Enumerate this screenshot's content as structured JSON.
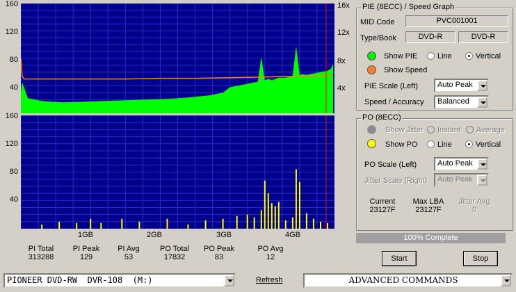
{
  "pie_graph": {
    "y_left_ticks": [
      "160",
      "120",
      "80",
      "40"
    ],
    "y_right_ticks": [
      "16x",
      "12x",
      "8x",
      "4x"
    ]
  },
  "po_graph": {
    "y_left_ticks": [
      "160",
      "120",
      "80",
      "40"
    ]
  },
  "x_axis_ticks": [
    "1GB",
    "2GB",
    "3GB",
    "4GB"
  ],
  "chart_data": [
    {
      "type": "area",
      "title": "PIE (8ECC)",
      "x_unit": "GB",
      "xlim": [
        0,
        4.5
      ],
      "ylim": [
        0,
        160
      ],
      "y2lim": [
        0,
        16
      ],
      "series": [
        {
          "name": "PIE",
          "color": "#00ff00",
          "x": [
            0,
            0.02,
            0.1,
            0.3,
            0.6,
            0.9,
            1.2,
            1.5,
            1.8,
            2.1,
            2.4,
            2.7,
            2.9,
            3.0,
            3.1,
            3.2,
            3.3,
            3.4,
            3.45,
            3.5,
            3.55,
            3.6,
            3.7,
            3.8,
            3.9,
            3.95,
            4.0,
            4.05,
            4.1,
            4.2,
            4.3,
            4.4,
            4.45,
            4.48
          ],
          "y": [
            30,
            45,
            22,
            18,
            16,
            17,
            18,
            19,
            20,
            21,
            23,
            26,
            30,
            38,
            40,
            42,
            44,
            46,
            82,
            48,
            50,
            48,
            52,
            52,
            55,
            98,
            56,
            57,
            56,
            58,
            60,
            62,
            65,
            72
          ]
        },
        {
          "name": "Speed",
          "color": "#ff8000",
          "x": [
            0,
            0.02,
            0.05,
            0.5,
            1.0,
            1.5,
            2.0,
            2.5,
            3.0,
            3.5,
            4.0,
            4.48
          ],
          "y": [
            8.0,
            5.4,
            5.0,
            5.0,
            5.0,
            5.0,
            5.1,
            5.1,
            5.2,
            5.3,
            5.4,
            5.6
          ]
        }
      ]
    },
    {
      "type": "bar",
      "title": "PO (8ECC)",
      "x_unit": "GB",
      "xlim": [
        0,
        4.5
      ],
      "ylim": [
        0,
        160
      ],
      "series": [
        {
          "name": "PO",
          "color": "#ffff00",
          "x": [
            0.3,
            0.55,
            0.8,
            1.0,
            1.15,
            1.45,
            1.7,
            2.1,
            2.4,
            2.65,
            2.9,
            3.1,
            3.25,
            3.35,
            3.45,
            3.5,
            3.55,
            3.6,
            3.65,
            3.7,
            3.8,
            3.9,
            3.95,
            4.0,
            4.1,
            4.2,
            4.3,
            4.4
          ],
          "y": [
            6,
            10,
            8,
            14,
            8,
            14,
            10,
            14,
            6,
            12,
            14,
            18,
            20,
            16,
            26,
            68,
            50,
            36,
            32,
            38,
            12,
            16,
            84,
            66,
            22,
            14,
            10,
            8
          ]
        }
      ]
    }
  ],
  "stats": [
    {
      "label": "PI Total",
      "value": "313288"
    },
    {
      "label": "PI Peak",
      "value": "129"
    },
    {
      "label": "PI Avg",
      "value": "53"
    },
    {
      "label": "PO Total",
      "value": "17832"
    },
    {
      "label": "PO Peak",
      "value": "83"
    },
    {
      "label": "PO Avg",
      "value": "12"
    }
  ],
  "pie_panel": {
    "title": "PIE (8ECC) / Speed Graph",
    "mid_label": "MID Code",
    "mid_value": "PVC001001",
    "type_label": "Type/Book",
    "type_value": "DVD-R",
    "book_value": "DVD-R",
    "show_pie": "Show PIE",
    "show_speed": "Show Speed",
    "line": "Line",
    "vertical": "Vertical",
    "scale_label": "PIE Scale (Left)",
    "scale_value": "Auto Peak",
    "accuracy_label": "Speed / Accuracy",
    "accuracy_value": "Balanced",
    "pie_color": "#00ee00",
    "speed_color": "#ff7f27"
  },
  "po_panel": {
    "title": "PO (8ECC)",
    "show_jitter": "Show Jitter",
    "instant": "Instant",
    "average": "Average",
    "show_po": "Show PO",
    "line": "Line",
    "vertical": "Vertical",
    "scale_label": "PO Scale (Left)",
    "scale_value": "Auto Peak",
    "jitter_label": "Jitter Scale (Right)",
    "jitter_value": "Auto Peak",
    "current_label": "Current",
    "current_value": "23127F",
    "maxlba_label": "Max LBA",
    "maxlba_value": "23127F",
    "jitter_avg_label": "Jitter Avg",
    "jitter_avg_value": "0",
    "po_color": "#ffff00"
  },
  "progress": {
    "text": "100% Complete",
    "percent": 100
  },
  "buttons": {
    "start": "Start",
    "stop": "Stop"
  },
  "bottom": {
    "drive": "PIONEER DVD-RW  DVR-108  (M:)",
    "refresh": "Refresh",
    "commands": "ADVANCED COMMANDS"
  }
}
